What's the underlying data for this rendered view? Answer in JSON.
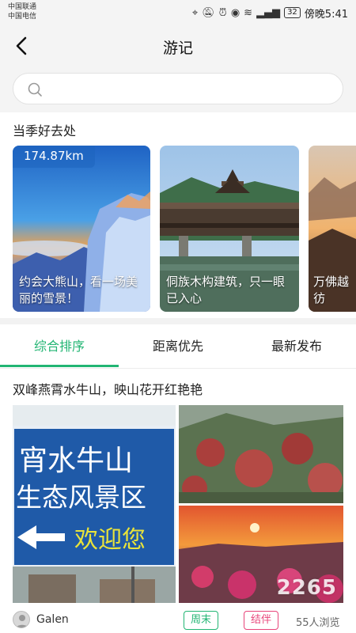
{
  "status_bar": {
    "carrier_1": "中国联通",
    "carrier_2": "中国电信",
    "battery": "32",
    "time": "傍晚5:41"
  },
  "header": {
    "title": "游记"
  },
  "search": {
    "placeholder": ""
  },
  "season": {
    "title": "当季好去处",
    "cards": [
      {
        "distance": "174.87km",
        "caption": "约会大熊山，看一场美丽的雪景！"
      },
      {
        "distance": "",
        "caption": "侗族木构建筑，只一眼已入心"
      },
      {
        "distance": "",
        "caption": "万佛越彷"
      }
    ]
  },
  "tabs": [
    {
      "label": "综合排序",
      "active": true
    },
    {
      "label": "距离优先",
      "active": false
    },
    {
      "label": "最新发布",
      "active": false
    }
  ],
  "post": {
    "title": "双峰燕霄水牛山，映山花开红艳艳",
    "sign_text_1": "宵水牛山",
    "sign_text_2": "生态风景区",
    "sign_text_3": "欢迎您",
    "author": "Galen",
    "tags": [
      "周末",
      "结伴"
    ],
    "views": "55人浏览"
  },
  "watermark": "2265",
  "colors": {
    "accent": "#22b573",
    "tag_pink": "#e8457a",
    "background": "#f4f4f4"
  }
}
